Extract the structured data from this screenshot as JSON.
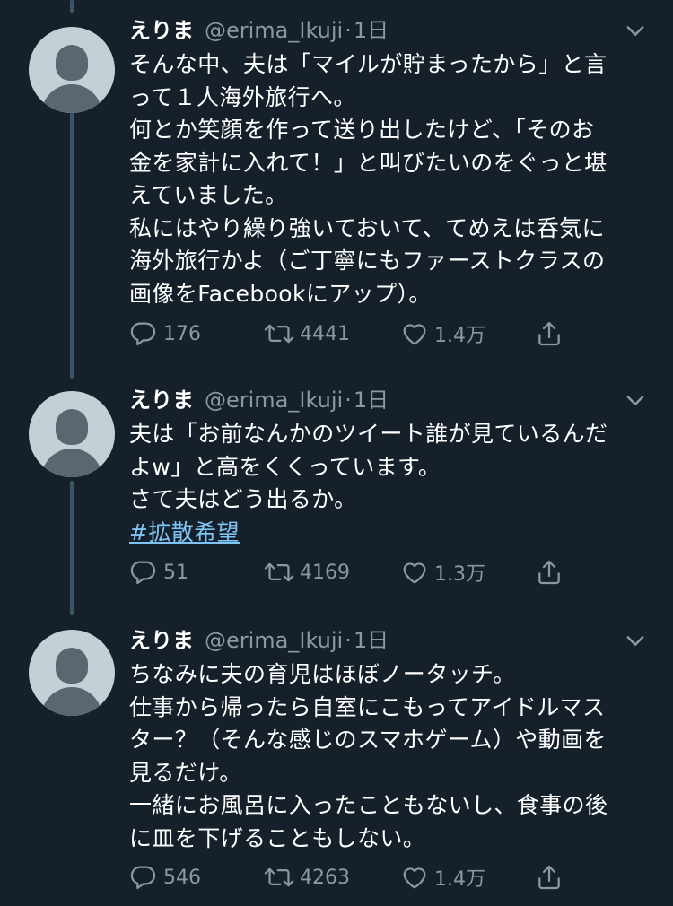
{
  "colors": {
    "background": "#15202b",
    "text": "#ffffff",
    "muted": "#8899a6",
    "link": "#7ec3f2",
    "thread_line": "#3d5466"
  },
  "icons": {
    "menu": "chevron-down-icon",
    "reply": "reply-icon",
    "retweet": "retweet-icon",
    "like": "heart-icon",
    "share": "share-icon"
  },
  "tweets": [
    {
      "name": "えりま",
      "handle": "@erima_Ikuji",
      "separator": "·",
      "time": "1日",
      "lines": [
        "そんな中、夫は「マイルが貯まったから」と言",
        "って１人海外旅行へ。",
        "何とか笑顔を作って送り出したけど、「そのお",
        "金を家計に入れて！」と叫びたいのをぐっと堪",
        "えていました。",
        "私にはやり繰り強いておいて、てめえは呑気に",
        "海外旅行かよ（ご丁寧にもファーストクラスの",
        "画像をFacebookにアップ）。"
      ],
      "hashtag": "",
      "replies": "176",
      "retweets": "4441",
      "likes": "1.4万"
    },
    {
      "name": "えりま",
      "handle": "@erima_Ikuji",
      "separator": "·",
      "time": "1日",
      "lines": [
        "夫は「お前なんかのツイート誰が見ているんだ",
        "よw」と高をくくっています。",
        "さて夫はどう出るか。"
      ],
      "hashtag": "#拡散希望",
      "replies": "51",
      "retweets": "4169",
      "likes": "1.3万"
    },
    {
      "name": "えりま",
      "handle": "@erima_Ikuji",
      "separator": "·",
      "time": "1日",
      "lines": [
        "ちなみに夫の育児はほぼノータッチ。",
        "仕事から帰ったら自室にこもってアイドルマス",
        "ター？（そんな感じのスマホゲーム）や動画を",
        "見るだけ。",
        "一緒にお風呂に入ったこともないし、食事の後",
        "に皿を下げることもしない。"
      ],
      "hashtag": "",
      "replies": "546",
      "retweets": "4263",
      "likes": "1.4万"
    }
  ]
}
